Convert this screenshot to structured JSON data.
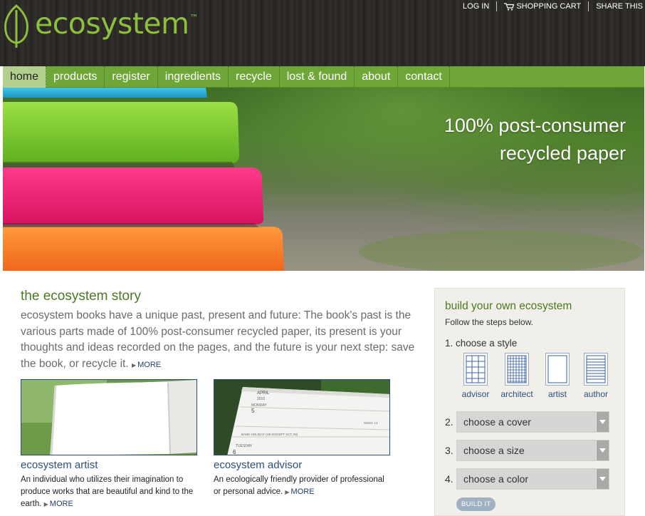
{
  "header": {
    "logo_text": "ecosystem",
    "logo_tm": "™",
    "util_links": [
      "LOG IN",
      "SHOPPING CART",
      "SHARE THIS"
    ]
  },
  "nav": {
    "items": [
      "home",
      "products",
      "register",
      "ingredients",
      "recycle",
      "lost & found",
      "about",
      "contact"
    ],
    "active": "home"
  },
  "hero": {
    "headline_line1": "100% post-consumer",
    "headline_line2": "recycled paper"
  },
  "story": {
    "title": "the ecosystem story",
    "text": "ecosystem books have a unique past, present and future: The book's past is the various parts made of 100% post-consumer recycled paper, its present is your thoughts and ideas recorded on the pages, and the future is your next step: save the book, or recycle it.",
    "more": "MORE"
  },
  "features": [
    {
      "title": "ecosystem artist",
      "desc": "An individual who utilizes their imagination to produce works that are beautiful and kind to the earth.",
      "more": "MORE"
    },
    {
      "title": "ecosystem advisor",
      "desc": "An ecologically friendly provider of professional or personal advice.",
      "more": "MORE",
      "thumb_text": {
        "month": "APRIL",
        "year": "2010",
        "day1": "MONDAY",
        "date1": "5",
        "day2": "TUESDAY",
        "date2": "6",
        "week": "WEEK 14",
        "note": "BANK HOLIDAY (UK EXCEPT SCT, NI)"
      }
    }
  ],
  "builder": {
    "title": "build your own ecosystem",
    "subtitle": "Follow the steps below.",
    "step1_label": "1. choose a style",
    "styles": [
      "advisor",
      "architect",
      "artist",
      "author"
    ],
    "steps": [
      {
        "num": "2.",
        "value": "choose a cover"
      },
      {
        "num": "3.",
        "value": "choose a size"
      },
      {
        "num": "4.",
        "value": "choose a color"
      }
    ],
    "build_label": "BUILD IT"
  },
  "colors": {
    "brand_green": "#8cbf3c",
    "nav_green": "#6ea637",
    "nav_active": "#b2cf8e",
    "link_blue": "#2b4f80"
  },
  "icons": [
    "leaf-logo-icon",
    "shopping-cart-icon",
    "more-arrow-icon",
    "dropdown-arrow-icon"
  ]
}
